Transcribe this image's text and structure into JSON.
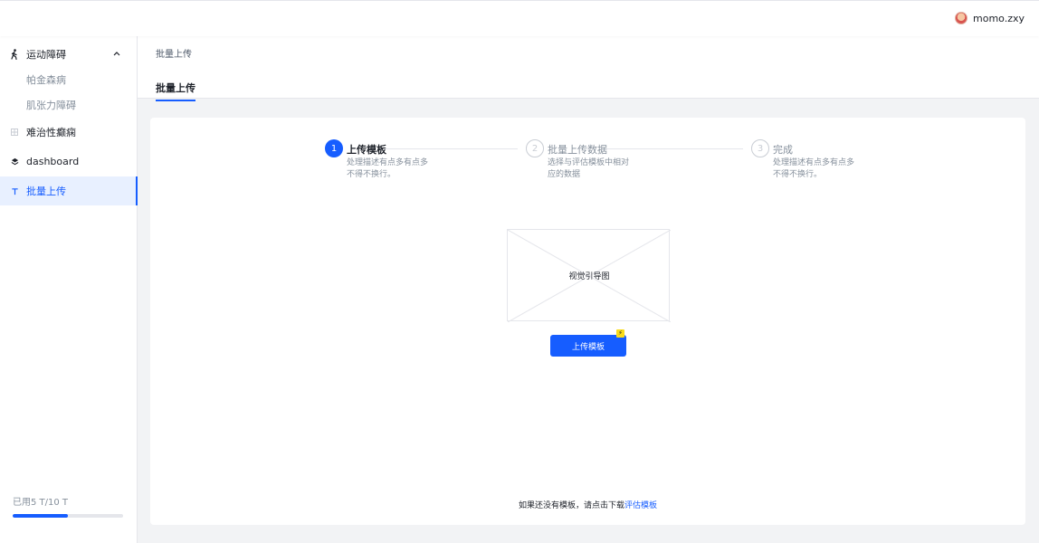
{
  "header": {
    "username": "momo.zxy",
    "avatar_icon": "avatar-icon"
  },
  "sidebar": {
    "items": [
      {
        "label": "运动障碍",
        "icon": "walking-person-icon",
        "expanded": true
      },
      {
        "label": "帕金森病",
        "sub": true
      },
      {
        "label": "肌张力障碍",
        "sub": true
      },
      {
        "label": "难治性癫痫",
        "icon": "grid-icon"
      },
      {
        "label": "dashboard",
        "icon": "layers-icon"
      },
      {
        "label": "批量上传",
        "icon": "text-t-icon",
        "active": true
      }
    ],
    "quota": {
      "text": "已用5 T/10 T",
      "used_fraction": 0.5
    }
  },
  "page": {
    "breadcrumb": "批量上传",
    "tab": "批量上传"
  },
  "steps": [
    {
      "num": "1",
      "title": "上传模板",
      "desc": "处理描述有点多有点多不得不换行。",
      "active": true
    },
    {
      "num": "2",
      "title": "批量上传数据",
      "desc": "选择与评估模板中相对应的数据",
      "active": false
    },
    {
      "num": "3",
      "title": "完成",
      "desc": "处理描述有点多有点多不得不换行。",
      "active": false
    }
  ],
  "illustration": {
    "label": "视觉引导图"
  },
  "upload_button": {
    "label": "上传模板",
    "badge": "⚡"
  },
  "hint": {
    "text": "如果还没有模板，请点击下载",
    "link": "评估模板"
  },
  "colors": {
    "primary": "#165dff",
    "active_bg": "#e8f0ff",
    "badge": "#fadc19"
  }
}
